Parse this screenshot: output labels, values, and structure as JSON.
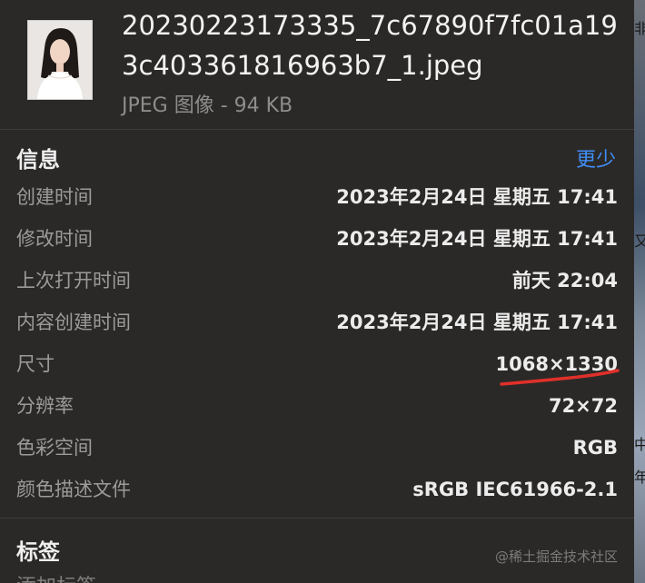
{
  "file": {
    "name": "20230223173335_7c67890f7fc01a193c403361816963b7_1.jpeg",
    "kind_and_size": "JPEG 图像 - 94 KB"
  },
  "info": {
    "title": "信息",
    "toggle_label": "更少",
    "rows": [
      {
        "label": "创建时间",
        "value": "2023年2月24日 星期五 17:41"
      },
      {
        "label": "修改时间",
        "value": "2023年2月24日 星期五 17:41"
      },
      {
        "label": "上次打开时间",
        "value": "前天 22:04"
      },
      {
        "label": "内容创建时间",
        "value": "2023年2月24日 星期五 17:41"
      },
      {
        "label": "尺寸",
        "value": "1068×1330"
      },
      {
        "label": "分辨率",
        "value": "72×72"
      },
      {
        "label": "色彩空间",
        "value": "RGB"
      },
      {
        "label": "颜色描述文件",
        "value": "sRGB IEC61966-2.1"
      }
    ]
  },
  "tags": {
    "title": "标签",
    "add_placeholder": "添加标签"
  },
  "watermark": "@稀土掘金技术社区",
  "right_strip_fragments": [
    "非",
    "又",
    "中",
    "年"
  ],
  "colors": {
    "background": "#2b2927",
    "link": "#3f8ef7",
    "annotation_underline": "#e0302a"
  }
}
